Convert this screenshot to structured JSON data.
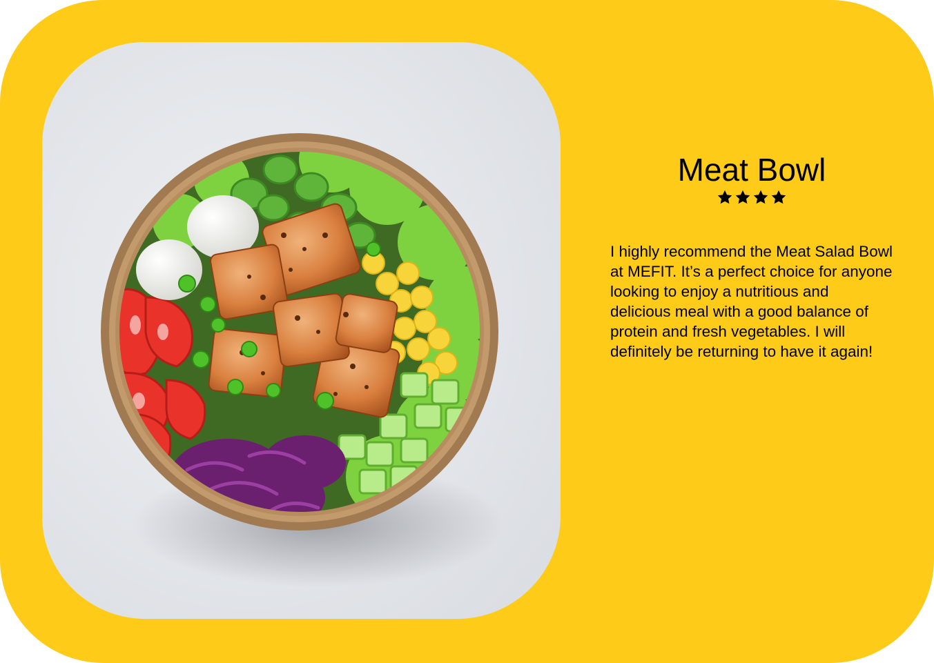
{
  "product": {
    "title": "Meat Bowl",
    "rating": 4,
    "rating_max": 4,
    "review": "I highly recommend the Meat Salad Bowl at MEFIT. It’s a perfect choice for anyone looking to enjoy a nutritious and delicious meal with a good balance of protein and fresh vegetables. I will definitely be returning to have it again!",
    "image_subject": "salad-bowl-photo"
  },
  "colors": {
    "card_background": "#FDCB18",
    "photo_background": "#E6E8EC",
    "text": "#000000",
    "star": "#000000"
  },
  "icons": {
    "rating_star": "star-icon"
  }
}
